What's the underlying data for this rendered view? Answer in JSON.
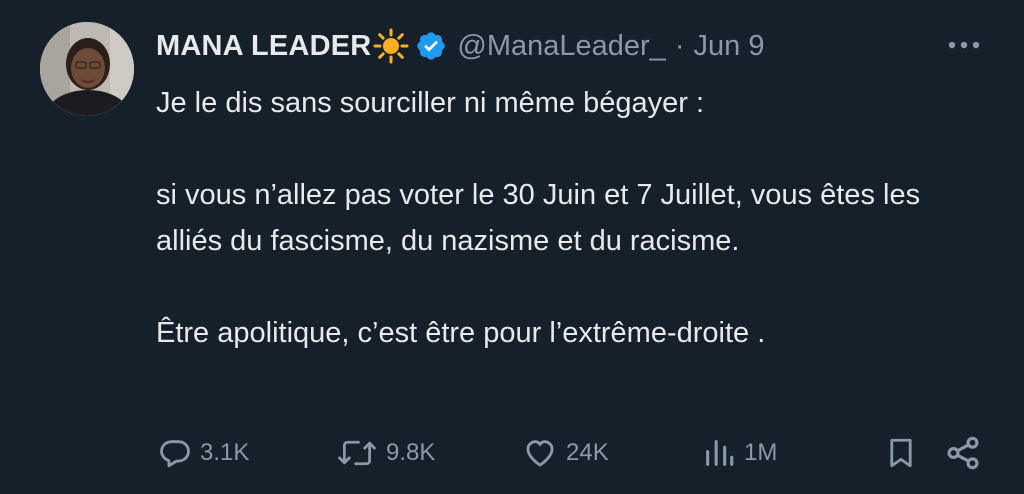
{
  "tweet": {
    "display_name": "MANA LEADER",
    "handle": "@ManaLeader_",
    "separator": "·",
    "date": "Jun 9",
    "paragraphs": [
      "Je le dis sans sourciller ni même bégayer :",
      "si vous n’allez pas voter le 30 Juin et 7 Juillet, vous êtes les alliés du fascisme, du nazisme et du racisme.",
      "Être apolitique, c’est être pour l’extrême-droite ."
    ]
  },
  "actions": {
    "replies": "3.1K",
    "retweets": "9.8K",
    "likes": "24K",
    "views": "1M"
  },
  "icons": {
    "name_emoji": "sun-icon",
    "badge": "verified-badge-icon",
    "more": "more-dots-icon",
    "reply": "reply-icon",
    "retweet": "retweet-icon",
    "like": "heart-icon",
    "views": "views-icon",
    "bookmark": "bookmark-icon",
    "share": "share-icon"
  },
  "colors": {
    "background": "#16202b",
    "text": "#e7e9ea",
    "secondary": "#8b98a5",
    "verified": "#1d9bf0",
    "sun": "#ffb01f"
  }
}
